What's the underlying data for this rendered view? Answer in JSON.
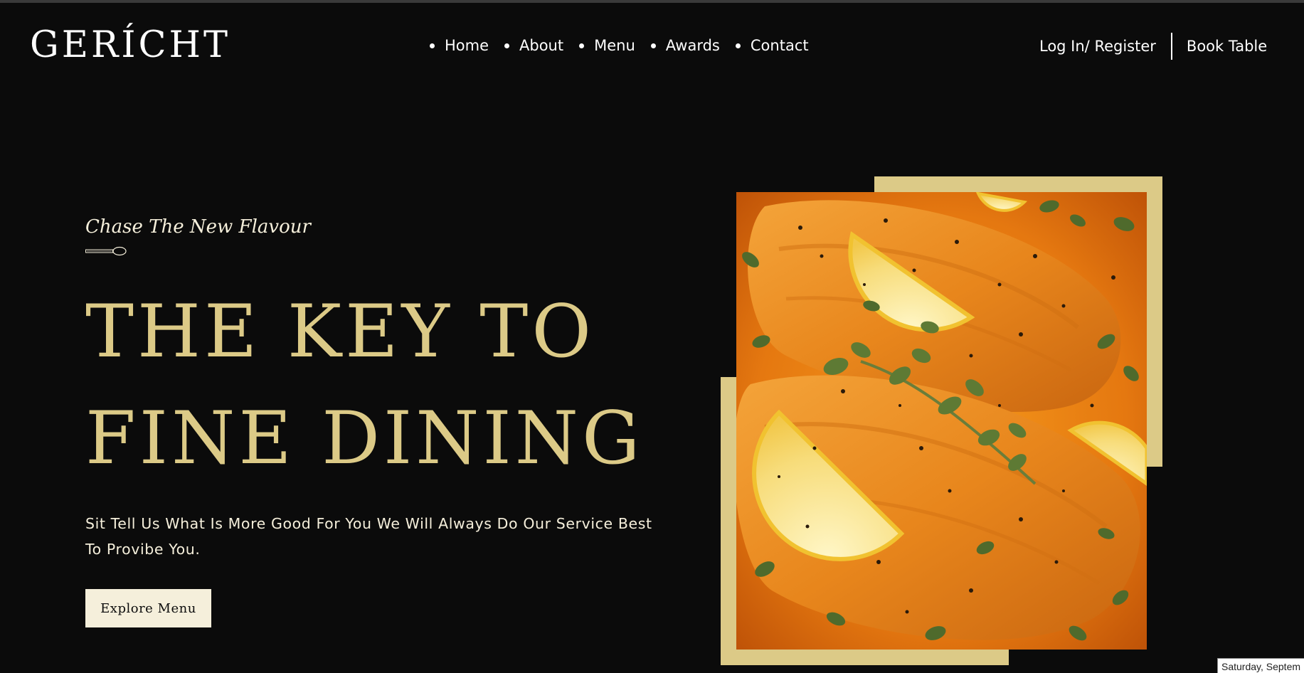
{
  "brand": {
    "logo_text": "GERÍCHT"
  },
  "nav": {
    "links": [
      {
        "label": "Home"
      },
      {
        "label": "About"
      },
      {
        "label": "Menu"
      },
      {
        "label": "Awards"
      },
      {
        "label": "Contact"
      }
    ],
    "login_label": "Log In/ Register",
    "book_label": "Book Table"
  },
  "hero": {
    "subtitle": "Chase The New Flavour",
    "headline_line1": "THE KEY TO",
    "headline_line2": "FINE DINING",
    "description": "Sit Tell Us What Is More Good For You We Will Always Do Our Service Best To Provibe You.",
    "cta_label": "Explore Menu"
  },
  "colors": {
    "background": "#0c0c0c",
    "accent_gold": "#dcca87",
    "cream": "#f5efdb",
    "white": "#ffffff"
  },
  "icons": {
    "nav_bullet": "bullet-dot-icon",
    "subtitle_decoration": "spoon-icon",
    "hero_image": "grilled-salmon-with-lemon-and-herbs"
  },
  "status_tooltip": {
    "text": "Saturday, Septem"
  }
}
